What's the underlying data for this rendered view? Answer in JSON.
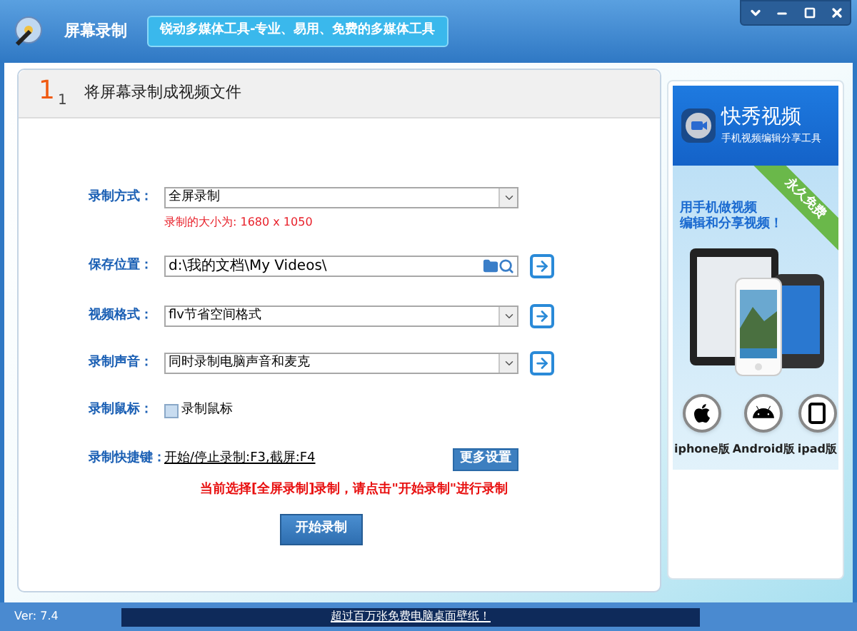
{
  "window": {
    "title": "屏幕录制",
    "slogan": "锐动多媒体工具-专业、易用、免费的多媒体工具"
  },
  "step": {
    "number": "1",
    "total": "1",
    "title": "将屏幕录制成视频文件"
  },
  "form": [
    {
      "kind": "select",
      "label": "录制方式：",
      "value": "全屏录制",
      "note": "录制的大小为: 1680 x 1050",
      "arrow": false
    },
    {
      "kind": "path",
      "label": "保存位置：",
      "value": "d:\\我的文档\\My Videos\\",
      "arrow": true
    },
    {
      "kind": "select",
      "label": "视频格式：",
      "value": "flv节省空间格式",
      "arrow": true
    },
    {
      "kind": "select",
      "label": "录制声音：",
      "value": "同时录制电脑声音和麦克",
      "arrow": true
    },
    {
      "kind": "checkbox",
      "label": "录制鼠标：",
      "value": "录制鼠标",
      "checked": false
    },
    {
      "kind": "hotkey",
      "label": "录制快捷键：",
      "value": "开始/停止录制:F3,截屏:F4",
      "button": "更多设置"
    }
  ],
  "warning": "当前选择[全屏录制]录制，请点击\"开始录制\"进行录制",
  "start_button": "开始录制",
  "ad": {
    "brand": "快秀视频",
    "tagline": "手机视频编辑分享工具",
    "ribbon": "永久免费",
    "headline": [
      "用手机做视频",
      "编辑和分享视频！"
    ],
    "platforms": [
      {
        "kind": "apple",
        "label": "iphone版"
      },
      {
        "kind": "android",
        "label": "Android版"
      },
      {
        "kind": "tablet",
        "label": "ipad版"
      }
    ]
  },
  "status_bar": {
    "version": "Ver: 7.4",
    "banner": "超过百万张免费电脑桌面壁纸！"
  }
}
